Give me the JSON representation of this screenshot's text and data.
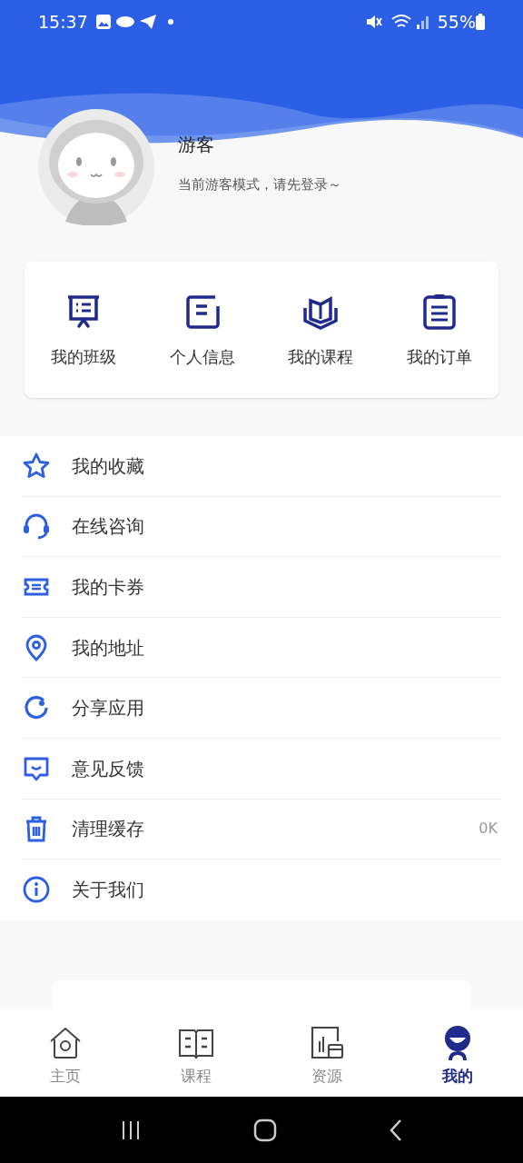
{
  "status_bar": {
    "time": "15:37",
    "battery": "55%"
  },
  "profile": {
    "name": "游客",
    "subtitle": "当前游客模式，请先登录～"
  },
  "shortcuts": [
    {
      "label": "我的班级"
    },
    {
      "label": "个人信息"
    },
    {
      "label": "我的课程"
    },
    {
      "label": "我的订单"
    }
  ],
  "menu": [
    {
      "label": "我的收藏"
    },
    {
      "label": "在线咨询"
    },
    {
      "label": "我的卡券"
    },
    {
      "label": "我的地址"
    },
    {
      "label": "分享应用"
    },
    {
      "label": "意见反馈"
    },
    {
      "label": "清理缓存",
      "value": "0K"
    },
    {
      "label": "关于我们"
    }
  ],
  "tabs": [
    {
      "label": "主页",
      "selected": false
    },
    {
      "label": "课程",
      "selected": false
    },
    {
      "label": "资源",
      "selected": false
    },
    {
      "label": "我的",
      "selected": true
    }
  ]
}
